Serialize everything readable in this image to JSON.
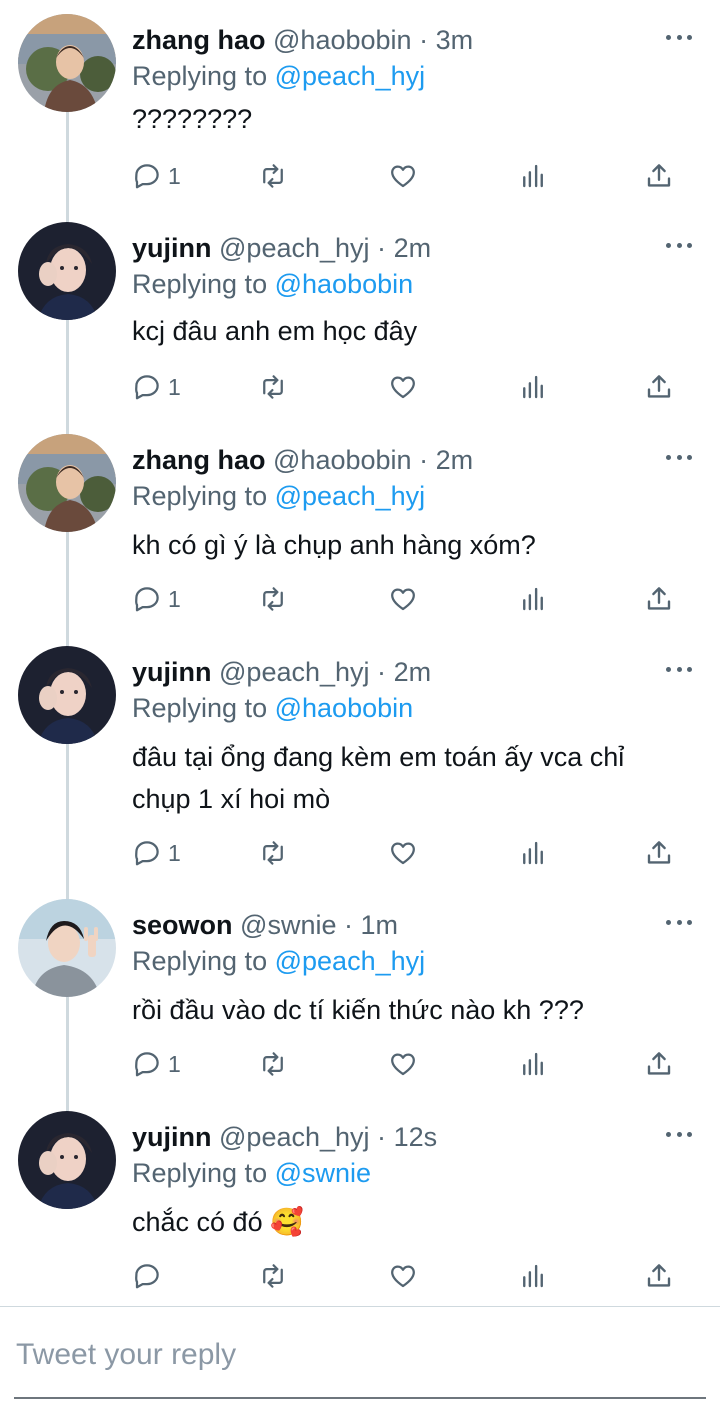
{
  "tweets": [
    {
      "name": "zhang hao",
      "handle": "@haobobin",
      "sep": "·",
      "time": "3m",
      "replying_prefix": "Replying to",
      "replying_to": "@peach_hyj",
      "text_lines": [
        "????????"
      ],
      "reply_count": "1"
    },
    {
      "name": "yujinn",
      "handle": "@peach_hyj",
      "sep": "·",
      "time": "2m",
      "replying_prefix": "Replying to",
      "replying_to": "@haobobin",
      "text_lines": [
        "kcj đâu anh em học đây"
      ],
      "reply_count": "1"
    },
    {
      "name": "zhang hao",
      "handle": "@haobobin",
      "sep": "·",
      "time": "2m",
      "replying_prefix": "Replying to",
      "replying_to": "@peach_hyj",
      "text_lines": [
        "kh có gì ý là chụp anh hàng xóm?"
      ],
      "reply_count": "1"
    },
    {
      "name": "yujinn",
      "handle": "@peach_hyj",
      "sep": "·",
      "time": "2m",
      "replying_prefix": "Replying to",
      "replying_to": "@haobobin",
      "text_lines": [
        "đâu tại ổng đang kèm em toán ấy vca chỉ",
        "chụp 1 xí hoi mò"
      ],
      "reply_count": "1"
    },
    {
      "name": "seowon",
      "handle": "@swnie",
      "sep": "·",
      "time": "1m",
      "replying_prefix": "Replying to",
      "replying_to": "@peach_hyj",
      "text_lines": [
        "rồi đầu vào dc tí kiến thức nào kh ???"
      ],
      "reply_count": "1"
    },
    {
      "name": "yujinn",
      "handle": "@peach_hyj",
      "sep": "·",
      "time": "12s",
      "replying_prefix": "Replying to",
      "replying_to": "@swnie",
      "text_lines": [
        "chắc có đó 🥰"
      ],
      "reply_count": ""
    }
  ],
  "reply_box": {
    "placeholder": "Tweet your reply"
  },
  "colors": {
    "accent": "#1d9bf0",
    "muted": "#536471",
    "text": "#0f1419",
    "thread_line": "#cfd9de"
  }
}
